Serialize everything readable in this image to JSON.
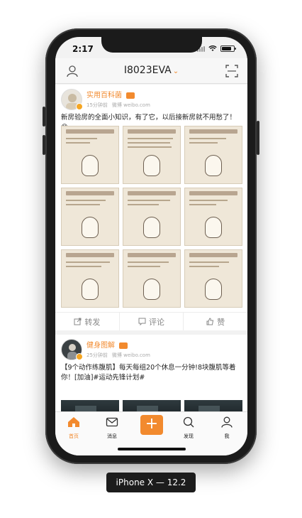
{
  "device_caption": "iPhone X — 12.2",
  "status": {
    "time": "2:17"
  },
  "nav": {
    "title": "I8023EVA",
    "caret": "⌄"
  },
  "posts": [
    {
      "author": "实用百科菌",
      "time": "15分钟前",
      "source": "微博 weibo.com",
      "text": "新房验房的全面小知识，有了它，以后接新房就不用愁了！😊",
      "actions": {
        "repost": "转发",
        "comment": "评论",
        "like": "赞"
      }
    },
    {
      "author": "健身图解",
      "time": "25分钟前",
      "source": "微博 weibo.com",
      "text": "【9个动作练腹肌】每天每组20个休息一分钟!8块腹肌等着你！[加油]#运动先锋计划#"
    }
  ],
  "tabs": [
    {
      "label": "首页",
      "icon": "home-icon",
      "active": true
    },
    {
      "label": "消息",
      "icon": "message-icon",
      "active": false
    },
    {
      "label": "发现",
      "icon": "search-icon",
      "active": false
    },
    {
      "label": "我",
      "icon": "person-icon",
      "active": false
    }
  ],
  "colors": {
    "accent": "#f28a2e",
    "device": "#1b1b1b"
  }
}
